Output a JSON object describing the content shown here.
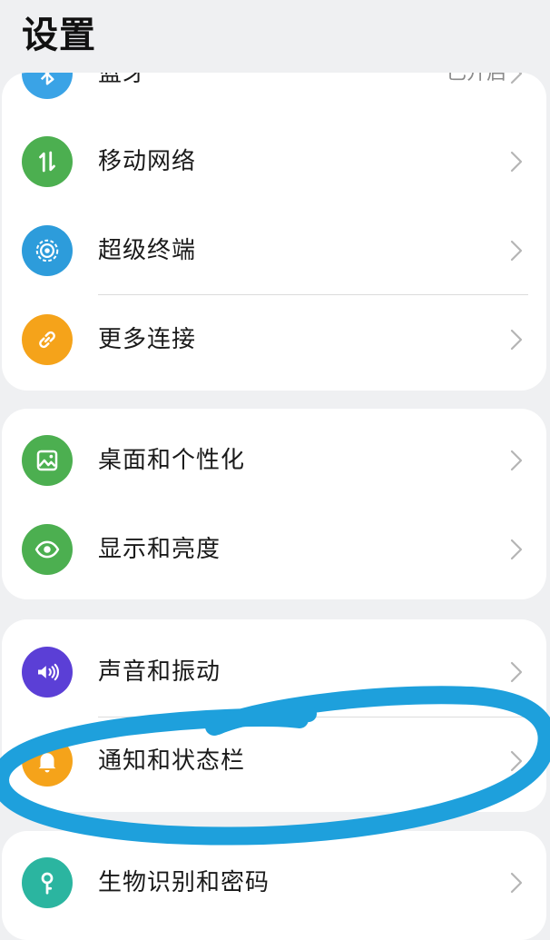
{
  "page": {
    "title": "设置"
  },
  "groups": [
    {
      "items": [
        {
          "label": "蓝牙",
          "value": "已开启",
          "icon": "bluetooth-icon",
          "color": "#3aa3e6"
        },
        {
          "label": "移动网络",
          "icon": "mobile-network-icon",
          "color": "#4caf50"
        },
        {
          "label": "超级终端",
          "icon": "super-device-icon",
          "color": "#2d9cdb"
        },
        {
          "label": "更多连接",
          "icon": "link-icon",
          "color": "#f5a31a"
        }
      ]
    },
    {
      "items": [
        {
          "label": "桌面和个性化",
          "icon": "wallpaper-icon",
          "color": "#4caf50"
        },
        {
          "label": "显示和亮度",
          "icon": "eye-icon",
          "color": "#4caf50"
        }
      ]
    },
    {
      "items": [
        {
          "label": "声音和振动",
          "icon": "speaker-icon",
          "color": "#5b3fd6"
        },
        {
          "label": "通知和状态栏",
          "icon": "bell-icon",
          "color": "#f5a31a"
        }
      ]
    },
    {
      "items": [
        {
          "label": "生物识别和密码",
          "icon": "key-icon",
          "color": "#2bb5a0"
        }
      ]
    }
  ],
  "annotation": {
    "color": "#1ea0dc",
    "shape": "hand-drawn-ellipse",
    "target": "通知和状态栏"
  }
}
